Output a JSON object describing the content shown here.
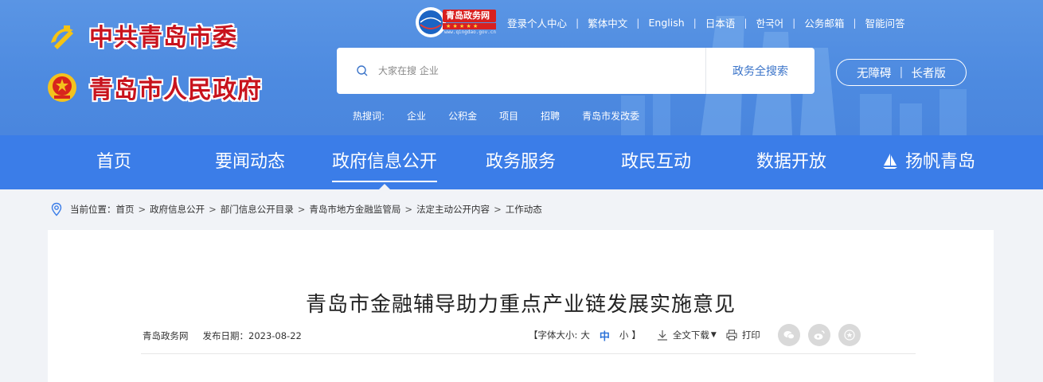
{
  "header": {
    "party_name": "中共青岛市委",
    "gov_name": "青岛市人民政府",
    "site_logo": {
      "name": "青岛政务网",
      "url": "www.qingdao.gov.cn"
    },
    "top_links": [
      "登录个人中心",
      "繁体中文",
      "English",
      "日本语",
      "한국어",
      "公务邮箱",
      "智能问答"
    ],
    "search": {
      "placeholder": "大家在搜 企业",
      "button": "政务全搜索"
    },
    "accessibility": {
      "barrier_free": "无障碍",
      "elder": "长者版"
    },
    "hotwords": {
      "label": "热搜词:",
      "items": [
        "企业",
        "公积金",
        "项目",
        "招聘",
        "青岛市发改委"
      ]
    }
  },
  "nav": {
    "items": [
      "首页",
      "要闻动态",
      "政府信息公开",
      "政务服务",
      "政民互动",
      "数据开放",
      "扬帆青岛"
    ],
    "active": "政府信息公开"
  },
  "breadcrumb": {
    "label": "当前位置：",
    "items": [
      "首页",
      "政府信息公开",
      "部门信息公开目录",
      "青岛市地方金融监管局",
      "法定主动公开内容",
      "工作动态"
    ]
  },
  "article": {
    "title": "青岛市金融辅导助力重点产业链发展实施意见",
    "source": "青岛政务网",
    "date_label": "发布日期：2023-08-22",
    "font_size": {
      "open": "【",
      "label": "字体大小:",
      "large": "大",
      "medium": "中",
      "small": "小",
      "close": "】"
    },
    "download": "全文下载",
    "print": "打印",
    "share_icons": [
      "wechat-icon",
      "weibo-icon",
      "favorite-icon"
    ]
  },
  "colors": {
    "header_blue": "#5a95e4",
    "nav_blue": "#3b7de8",
    "brand_red": "#c8131d",
    "link_blue": "#2d73d8"
  }
}
